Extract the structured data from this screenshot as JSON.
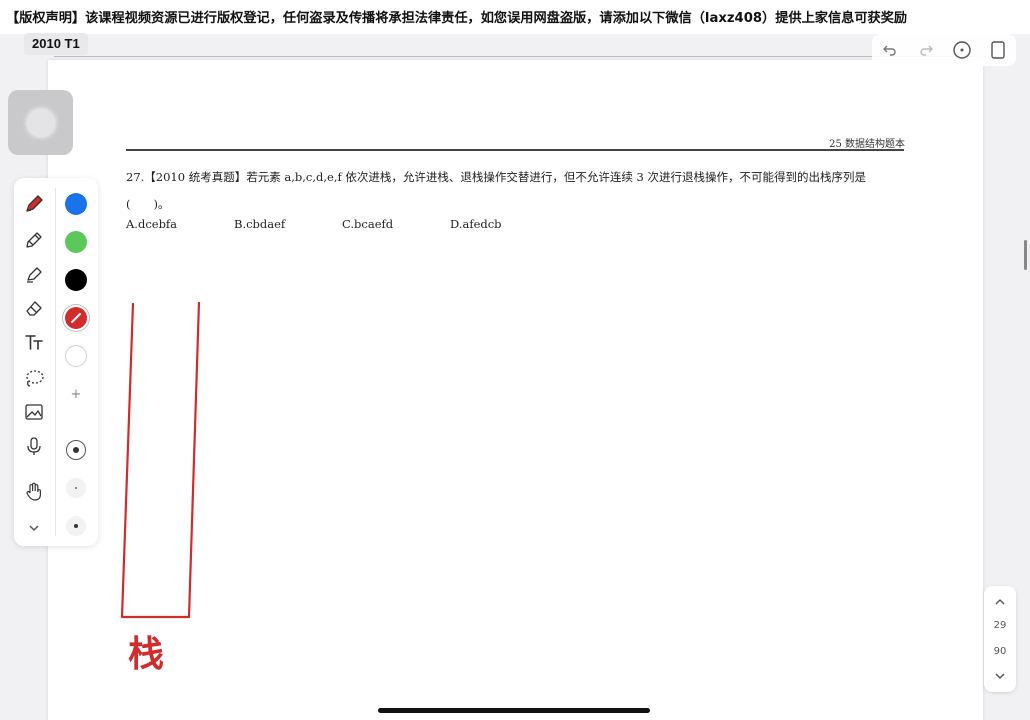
{
  "banner": {
    "text": "【版权声明】该课程视频资源已进行版权登记，任何盗录及传播将承担法律责任，如您误用网盘盗版，请添加以下微信（laxz408）提供上家信息可获奖励"
  },
  "doc": {
    "tab_title": "2010 T1"
  },
  "topbar": {
    "icons": [
      "undo-icon",
      "redo-icon",
      "more-icon",
      "page-view-icon"
    ]
  },
  "page": {
    "header": "25 数据结构题本",
    "question": "27.【2010 统考真题】若元素 a,b,c,d,e,f 依次进栈，允许进栈、退栈操作交替进行，但不允许连续 3 次进行退栈操作，不可能得到的出栈序列是(　　)。",
    "options": [
      "A.dcebfa",
      "B.cbdaef",
      "C.bcaefd",
      "D.afedcb"
    ]
  },
  "annotation": {
    "label": "栈",
    "color": "#d22b2b"
  },
  "toolbar": {
    "tools": [
      "pen-tool",
      "pencil-tool",
      "highlighter-tool",
      "eraser-tool",
      "text-tool",
      "lasso-tool",
      "image-tool",
      "mic-tool",
      "hand-tool",
      "collapse-tool"
    ],
    "colors": [
      "#1a73e8",
      "#5ac85a",
      "#000000",
      "#d22b2b",
      "#ffffff"
    ],
    "add_label": "+"
  },
  "pager": {
    "current": "29",
    "total": "90"
  }
}
